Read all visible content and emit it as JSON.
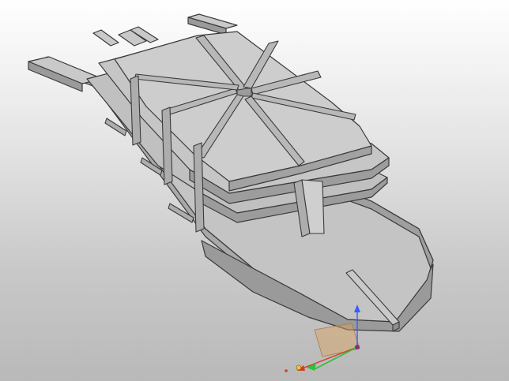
{
  "viewport": {
    "name": "3d-model-viewport",
    "background_top": "#ffffff",
    "background_bottom": "#b9b9b9"
  },
  "model": {
    "kind": "boat-hull-frame-assembly",
    "face_color": "#bdbdbd",
    "top_color": "#c9c9c9",
    "side_color": "#9a9a9a",
    "edge_color": "#3a3a3a"
  },
  "gizmo": {
    "x_axis_color": "#d23a2a",
    "y_axis_color": "#2fbf3a",
    "z_axis_color": "#3a5cff",
    "plane_color": "#d9a25a",
    "origin_color": "#f2c230"
  }
}
